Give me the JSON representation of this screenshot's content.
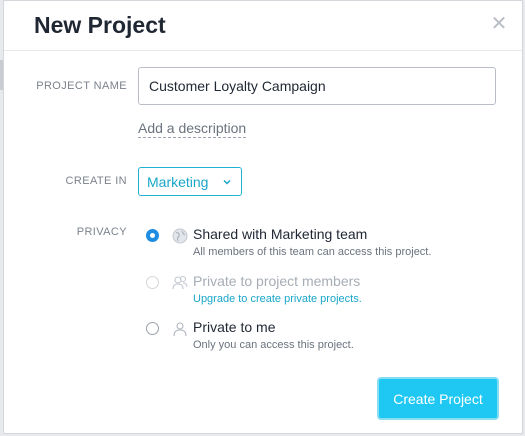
{
  "dialog": {
    "title": "New Project"
  },
  "form": {
    "project_name_label": "PROJECT NAME",
    "project_name_value": "Customer Loyalty Campaign",
    "add_description": "Add a description",
    "create_in_label": "CREATE IN",
    "create_in_value": "Marketing",
    "privacy_label": "PRIVACY",
    "privacy_options": [
      {
        "title": "Shared with Marketing team",
        "description": "All members of this team can access this project.",
        "selected": true,
        "enabled": true,
        "icon": "globe-icon"
      },
      {
        "title": "Private to project members",
        "description": "Upgrade to create private projects.",
        "selected": false,
        "enabled": false,
        "icon": "members-icon"
      },
      {
        "title": "Private to me",
        "description": "Only you can access this project.",
        "selected": false,
        "enabled": true,
        "icon": "person-icon"
      }
    ]
  },
  "actions": {
    "create_label": "Create Project"
  },
  "colors": {
    "accent": "#1fc8f2",
    "link": "#19a6c8",
    "radio_selected": "#1f8de2"
  }
}
